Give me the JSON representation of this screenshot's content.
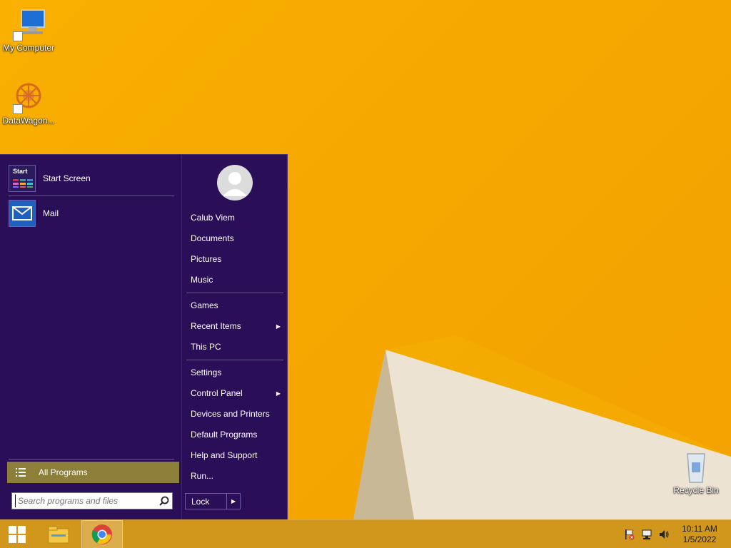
{
  "desktop": {
    "icons": [
      {
        "label": "My Computer"
      },
      {
        "label": "DataWagon..."
      },
      {
        "label": "Recycle Bin"
      }
    ]
  },
  "start_menu": {
    "pinned": [
      {
        "label": "Start Screen",
        "tile_text": "Start"
      },
      {
        "label": "Mail"
      }
    ],
    "all_programs": "All Programs",
    "search_placeholder": "Search programs and files",
    "user": {
      "name": "Calub Viem"
    },
    "right_items": [
      {
        "label": "Documents"
      },
      {
        "label": "Pictures"
      },
      {
        "label": "Music"
      },
      {
        "label": "Games"
      },
      {
        "label": "Recent Items",
        "submenu": true
      },
      {
        "label": "This PC"
      },
      {
        "label": "Settings"
      },
      {
        "label": "Control Panel",
        "submenu": true
      },
      {
        "label": "Devices and Printers"
      },
      {
        "label": "Default Programs"
      },
      {
        "label": "Help and Support"
      },
      {
        "label": "Run..."
      }
    ],
    "lock": "Lock"
  },
  "taskbar": {
    "apps": [
      "start-button",
      "file-explorer",
      "chrome"
    ],
    "clock": {
      "time": "10:11 AM",
      "date": "1/5/2022"
    }
  },
  "colors": {
    "menu_bg": "#2a0e57",
    "all_programs_bg": "#8c7f3a",
    "wallpaper": "#f6a800"
  }
}
